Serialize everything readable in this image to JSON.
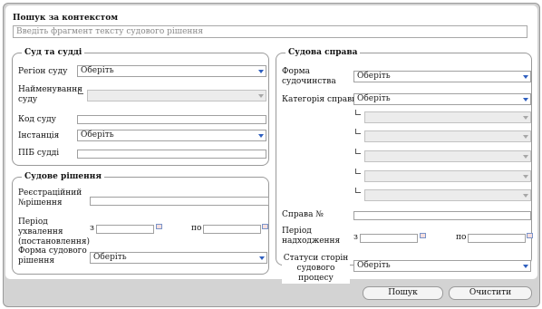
{
  "search": {
    "title": "Пошук за контекстом",
    "placeholder": "Введіть фрагмент тексту судового рішення"
  },
  "court": {
    "legend": "Суд та судді",
    "region_label": "Регіон суду",
    "region_value": "Оберіть",
    "name_label": "Найменування суду",
    "code_label": "Код суду",
    "instance_label": "Інстанція",
    "instance_value": "Оберіть",
    "judges_label": "ПІБ судді"
  },
  "decision": {
    "legend": "Судове рішення",
    "reg_label": "Реєстраційний №рішення",
    "period_label": "Період ухвалення (постановлення)",
    "from": "з",
    "to": "по",
    "form_label": "Форма судового рішення",
    "form_value": "Оберіть"
  },
  "case": {
    "legend": "Судова справа",
    "form_label": "Форма судочинства",
    "form_value": "Оберіть",
    "category_label": "Категорія справи",
    "category_value": "Оберіть",
    "number_label": "Справа №",
    "period_label": "Період надходження",
    "from": "з",
    "to": "по",
    "status_label": "Статуси сторін судового процесу",
    "status_value": "Оберіть"
  },
  "buttons": {
    "search": "Пошук",
    "clear": "Очистити"
  },
  "colors": {
    "arrow": "#2f5fbf",
    "frame": "#d3d3d3"
  }
}
